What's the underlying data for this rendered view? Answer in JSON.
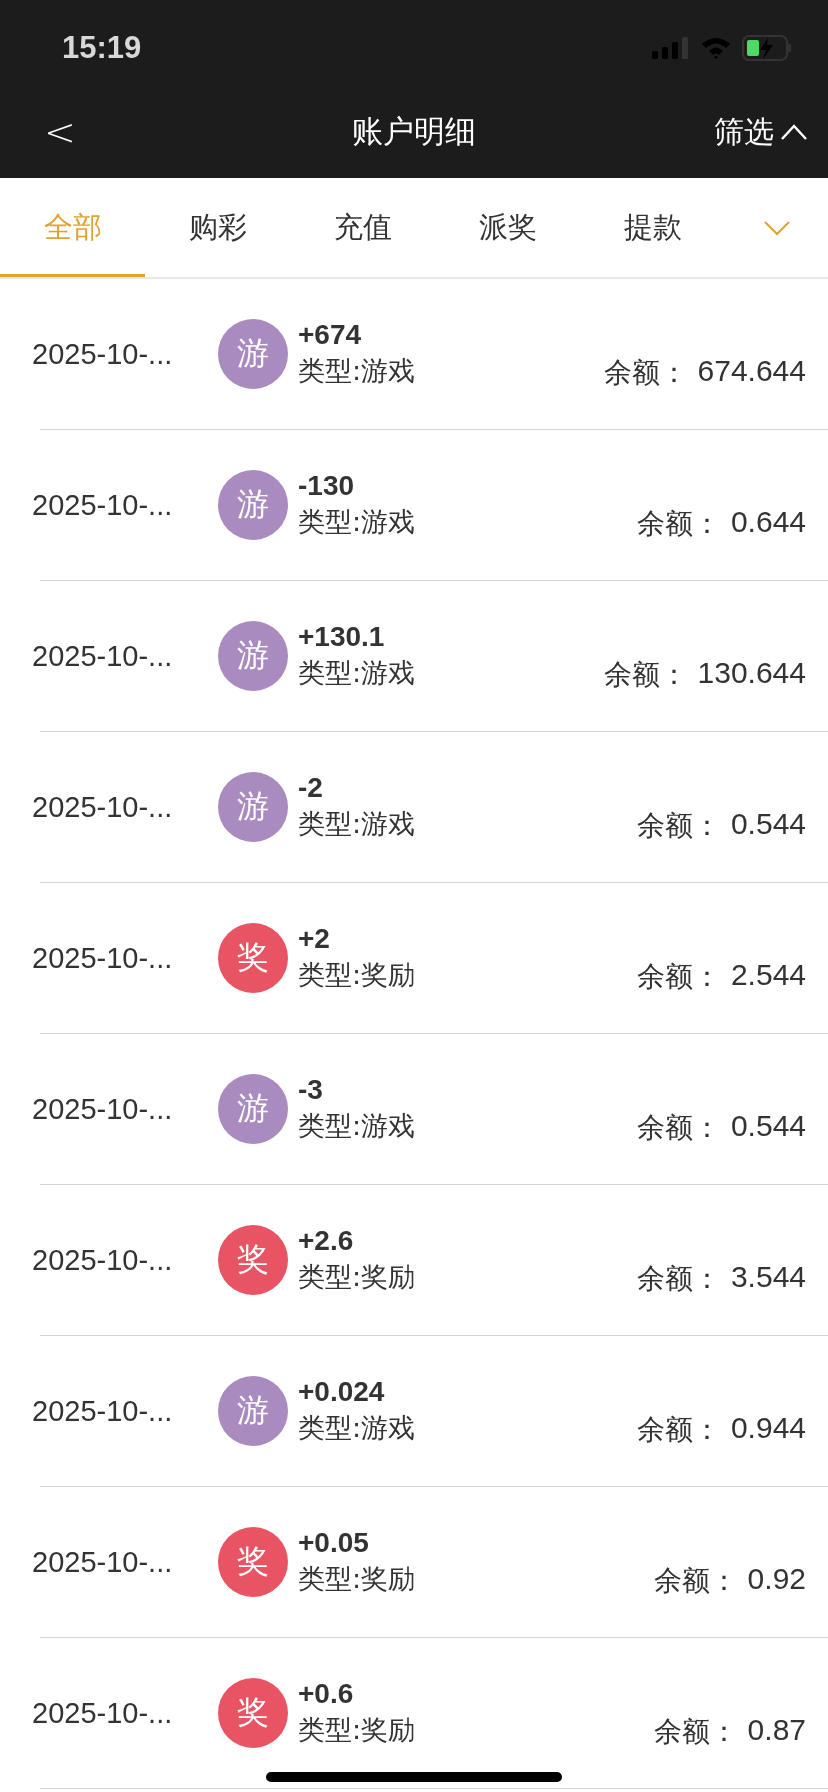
{
  "status_bar": {
    "time": "15:19"
  },
  "nav": {
    "back": "<",
    "title": "账户明细",
    "filter": "筛选"
  },
  "tabs": [
    {
      "label": "全部",
      "selected": true
    },
    {
      "label": "购彩",
      "selected": false
    },
    {
      "label": "充值",
      "selected": false
    },
    {
      "label": "派奖",
      "selected": false
    },
    {
      "label": "提款",
      "selected": false
    }
  ],
  "rows": [
    {
      "date": "2025-10-...",
      "badge": "游",
      "color": "#a98bbf",
      "amount": "+674",
      "type": "类型:游戏",
      "balance_label": "余额：",
      "balance": "674.644"
    },
    {
      "date": "2025-10-...",
      "badge": "游",
      "color": "#a98bbf",
      "amount": "-130",
      "type": "类型:游戏",
      "balance_label": "余额：",
      "balance": "0.644"
    },
    {
      "date": "2025-10-...",
      "badge": "游",
      "color": "#a98bbf",
      "amount": "+130.1",
      "type": "类型:游戏",
      "balance_label": "余额：",
      "balance": "130.644"
    },
    {
      "date": "2025-10-...",
      "badge": "游",
      "color": "#a98bbf",
      "amount": "-2",
      "type": "类型:游戏",
      "balance_label": "余额：",
      "balance": "0.544"
    },
    {
      "date": "2025-10-...",
      "badge": "奖",
      "color": "#e85464",
      "amount": "+2",
      "type": "类型:奖励",
      "balance_label": "余额：",
      "balance": "2.544"
    },
    {
      "date": "2025-10-...",
      "badge": "游",
      "color": "#a98bbf",
      "amount": "-3",
      "type": "类型:游戏",
      "balance_label": "余额：",
      "balance": "0.544"
    },
    {
      "date": "2025-10-...",
      "badge": "奖",
      "color": "#e85464",
      "amount": "+2.6",
      "type": "类型:奖励",
      "balance_label": "余额：",
      "balance": "3.544"
    },
    {
      "date": "2025-10-...",
      "badge": "游",
      "color": "#a98bbf",
      "amount": "+0.024",
      "type": "类型:游戏",
      "balance_label": "余额：",
      "balance": "0.944"
    },
    {
      "date": "2025-10-...",
      "badge": "奖",
      "color": "#e85464",
      "amount": "+0.05",
      "type": "类型:奖励",
      "balance_label": "余额：",
      "balance": "0.92"
    },
    {
      "date": "2025-10-...",
      "badge": "奖",
      "color": "#e85464",
      "amount": "+0.6",
      "type": "类型:奖励",
      "balance_label": "余额：",
      "balance": "0.87"
    }
  ]
}
